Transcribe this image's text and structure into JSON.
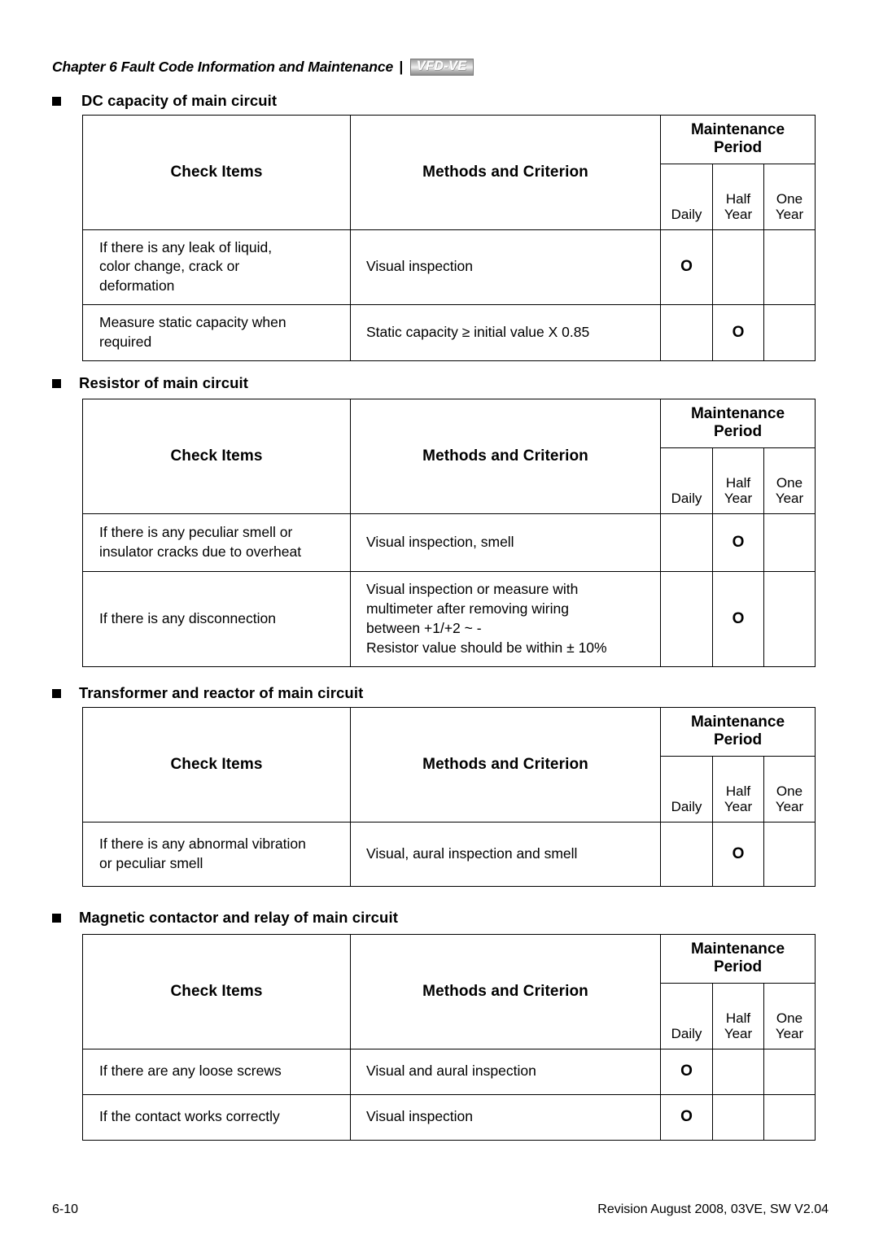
{
  "header": {
    "chapter": "Chapter 6 Fault Code Information and Maintenance",
    "separator": "|",
    "logo": "VFD-VE"
  },
  "table_headers": {
    "check_items": "Check Items",
    "methods": "Methods and Criterion",
    "period": "Maintenance\nPeriod",
    "period_line1": "Maintenance",
    "period_line2": "Period",
    "daily": "Daily",
    "half_year_line1": "Half",
    "half_year_line2": "Year",
    "one_year_line1": "One",
    "one_year_line2": "Year"
  },
  "mark": "O",
  "sections": [
    {
      "id": "dc-capacity",
      "title": "DC capacity of main circuit",
      "rows": [
        {
          "check": "If there is any leak of liquid, color change, crack or deformation",
          "check_lines": [
            "If there is any leak of liquid,",
            "color change, crack or",
            "deformation"
          ],
          "method_lines": [
            "Visual inspection"
          ],
          "daily": "O",
          "half_year": "",
          "one_year": ""
        },
        {
          "check": "Measure static capacity when required",
          "check_lines": [
            "Measure static capacity when",
            "required"
          ],
          "method_lines": [
            "Static capacity ≥ initial value X 0.85"
          ],
          "daily": "",
          "half_year": "O",
          "one_year": ""
        }
      ]
    },
    {
      "id": "resistor",
      "title": "Resistor of main circuit",
      "rows": [
        {
          "check": "If there is any peculiar smell or insulator cracks due to overheat",
          "check_lines": [
            "If there is any peculiar smell or",
            "insulator cracks due to overheat"
          ],
          "method_lines": [
            "Visual inspection, smell"
          ],
          "daily": "",
          "half_year": "O",
          "one_year": ""
        },
        {
          "check": "If there is any disconnection",
          "check_lines": [
            "If there is any disconnection"
          ],
          "method_lines": [
            "Visual inspection or measure with",
            "multimeter after removing wiring",
            "between +1/+2 ~ -",
            "Resistor value should be within ± 10%"
          ],
          "daily": "",
          "half_year": "O",
          "one_year": ""
        }
      ]
    },
    {
      "id": "transformer-reactor",
      "title": "Transformer and reactor of main circuit",
      "rows": [
        {
          "check": "If there is any abnormal vibration or peculiar smell",
          "check_lines": [
            "If there is any abnormal vibration",
            "or peculiar smell"
          ],
          "method_lines": [
            "Visual, aural inspection and smell"
          ],
          "daily": "",
          "half_year": "O",
          "one_year": ""
        }
      ]
    },
    {
      "id": "magnetic-contactor",
      "title": "Magnetic contactor and relay of main circuit",
      "rows": [
        {
          "check": "If there are any loose screws",
          "check_lines": [
            "If there are any loose screws"
          ],
          "method_lines": [
            "Visual and aural inspection"
          ],
          "daily": "O",
          "half_year": "",
          "one_year": ""
        },
        {
          "check": "If the contact works correctly",
          "check_lines": [
            "If the contact works correctly"
          ],
          "method_lines": [
            "Visual inspection"
          ],
          "daily": "O",
          "half_year": "",
          "one_year": ""
        }
      ]
    }
  ],
  "footer": {
    "page_number": "6-10",
    "revision": "Revision August 2008, 03VE, SW V2.04"
  }
}
